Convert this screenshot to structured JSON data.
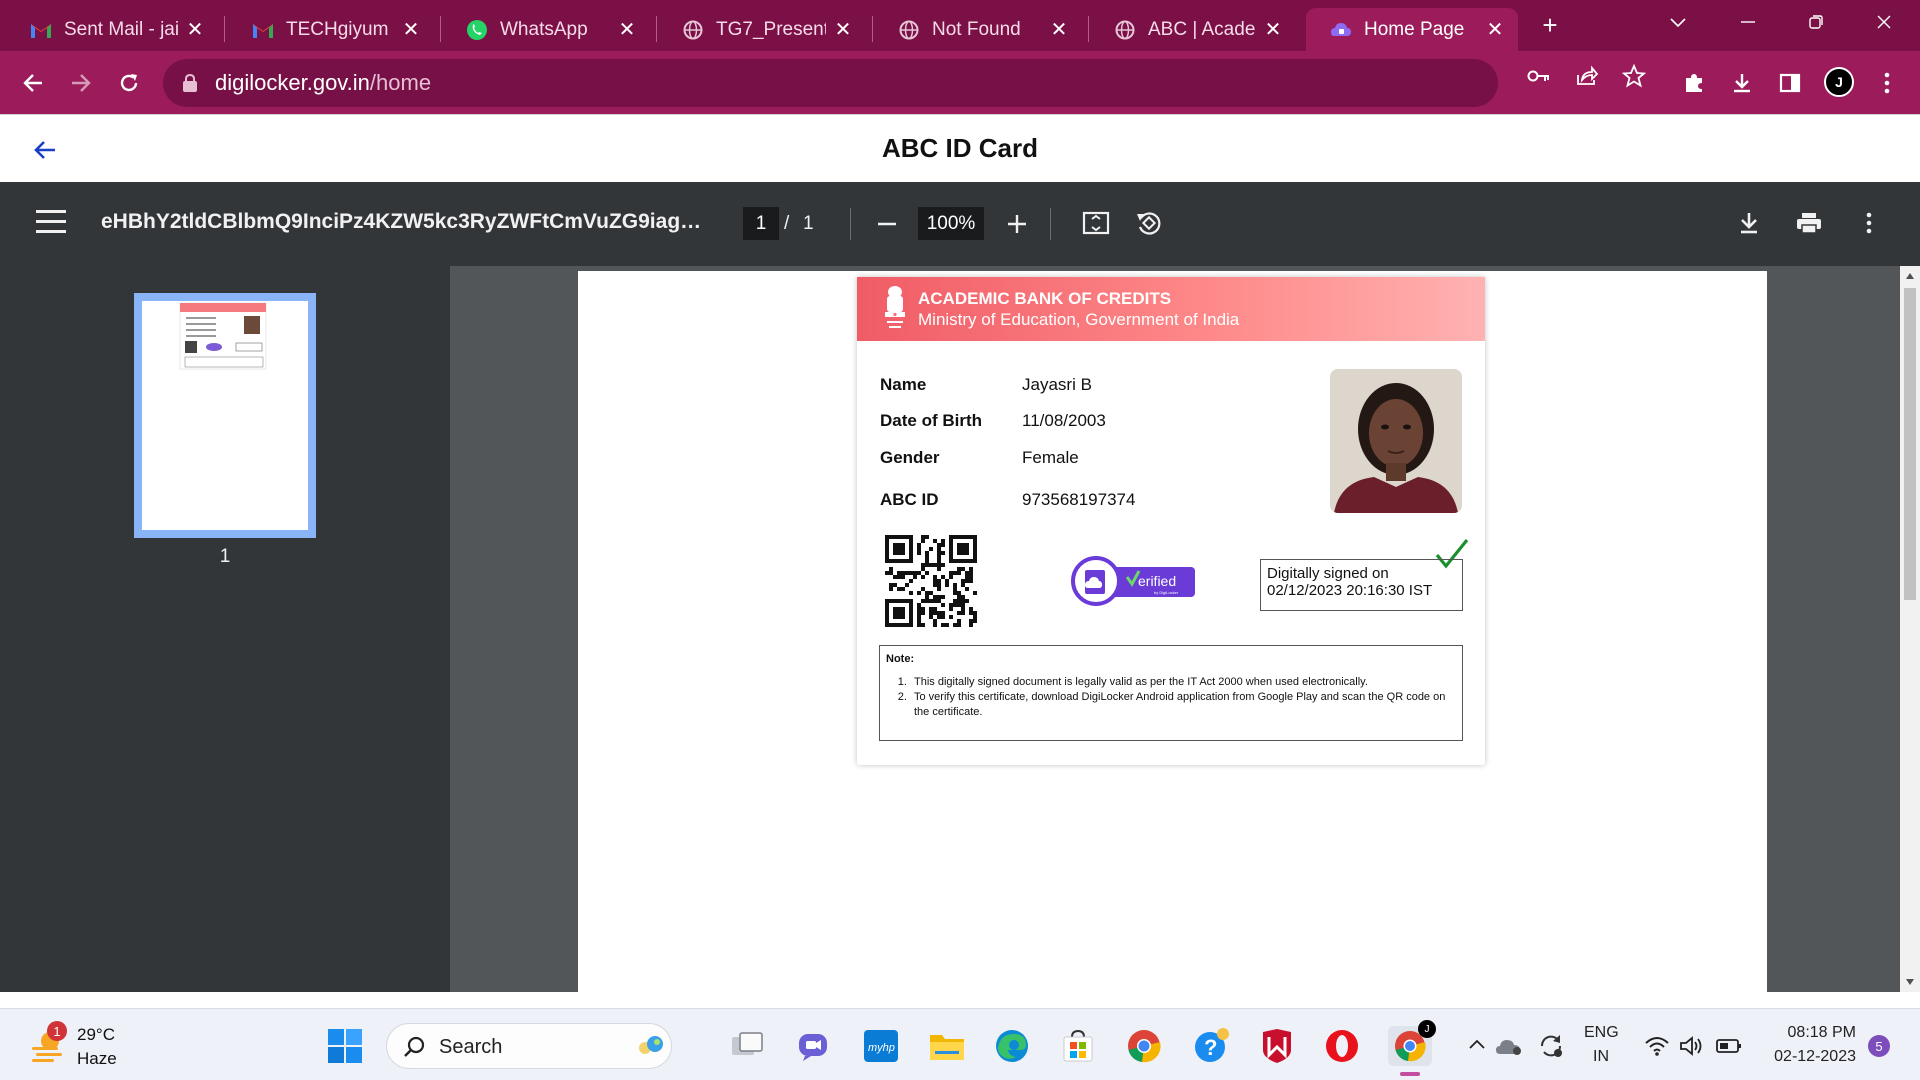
{
  "browser": {
    "tabs": [
      {
        "title": "Sent Mail - jail",
        "icon": "gmail-icon"
      },
      {
        "title": "TECHgiyum - ",
        "icon": "gmail-icon"
      },
      {
        "title": "WhatsApp",
        "icon": "whatsapp-icon"
      },
      {
        "title": "TG7_Presentat",
        "icon": "globe-icon"
      },
      {
        "title": "Not Found",
        "icon": "globe-icon"
      },
      {
        "title": "ABC | Academ",
        "icon": "globe-icon"
      },
      {
        "title": "Home Page",
        "icon": "digilocker-icon",
        "active": true
      }
    ],
    "url_host": "digilocker.gov.in",
    "url_path": "/home",
    "profile_initial": "J",
    "colors": {
      "frame": "#7a1046",
      "toolbar": "#9c1c5b"
    }
  },
  "page": {
    "title": "ABC ID Card"
  },
  "pdf_viewer": {
    "filename": "eHBhY2tldCBlbmQ9InciPz4KZW5kc3RyZWFtCmVuZG9iago5O...",
    "page_current": "1",
    "page_sep": "/",
    "page_total": "1",
    "zoom": "100%",
    "thumbnail_label": "1"
  },
  "card": {
    "header_title": "ACADEMIC BANK OF CREDITS",
    "header_subtitle": "Ministry of Education, Government of India",
    "fields": [
      {
        "label": "Name",
        "value": "Jayasri B"
      },
      {
        "label": "Date of Birth",
        "value": "11/08/2003"
      },
      {
        "label": "Gender",
        "value": "Female"
      },
      {
        "label": "ABC ID",
        "value": "973568197374"
      }
    ],
    "verified_text": "erified",
    "verified_sub": "by DigiLocker",
    "signed_line1": "Digitally signed on",
    "signed_line2": "02/12/2023 20:16:30 IST",
    "note_title": "Note:",
    "notes": [
      "This digitally signed document is legally valid as per the IT Act 2000 when used electronically.",
      "To verify this certificate, download DigiLocker Android application from Google Play and scan the QR code on the certificate."
    ],
    "colors": {
      "header_start": "#f05c66",
      "header_end": "#ffb2b2",
      "check": "#1a8f2e",
      "verified": "#6a3bd6"
    }
  },
  "taskbar": {
    "weather_temp": "29°C",
    "weather_cond": "Haze",
    "weather_badge": "1",
    "search_label": "Search",
    "lang_line1": "ENG",
    "lang_line2": "IN",
    "time": "08:18 PM",
    "date": "02-12-2023",
    "notification_count": "5",
    "chrome_badge": "J"
  }
}
